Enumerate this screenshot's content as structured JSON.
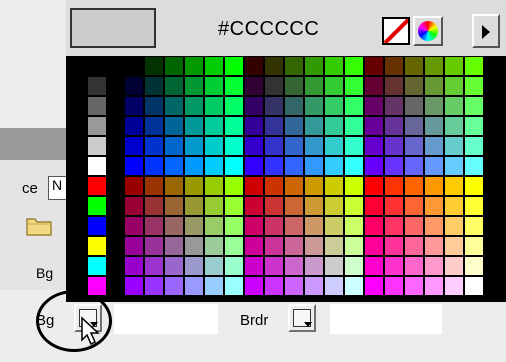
{
  "form": {
    "partial_label": "ce",
    "input_value": "N",
    "bg_label_upper": "Bg",
    "bg_label": "Bg",
    "brdr_label": "Brdr"
  },
  "picker": {
    "hex_value": "#CCCCCC",
    "preview_color": "#cccccc",
    "no_color_icon": "no-color-icon",
    "wheel_icon": "color-wheel-icon",
    "menu_icon": "menu-arrow-icon"
  }
}
